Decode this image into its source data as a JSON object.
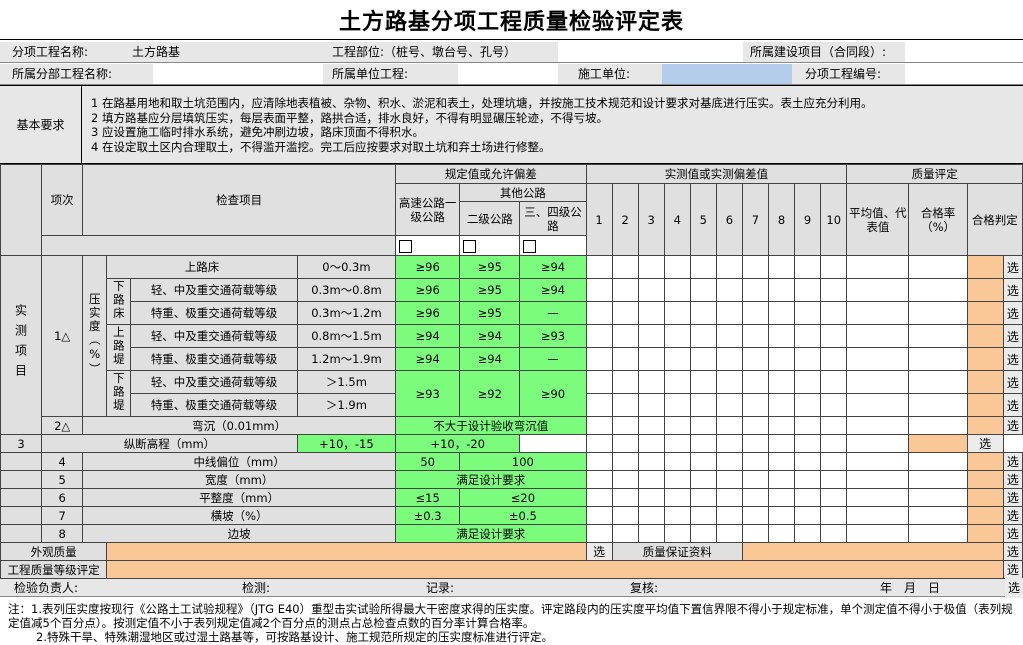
{
  "title": "土方路基分项工程质量检验评定表",
  "header": {
    "subitem_name_label": "分项工程名称:",
    "subitem_name_value": "土方路基",
    "location_label": "工程部位:（桩号、墩台号、孔号）",
    "project_label": "所属建设项目（合同段）:",
    "division_label": "所属分部工程名称:",
    "unit_label": "所属单位工程:",
    "contractor_label": "施工单位:",
    "code_label": "分项工程编号:"
  },
  "requirements": {
    "label": "基本要求",
    "lines": [
      "1 在路基用地和取土坑范围内，应清除地表植被、杂物、积水、淤泥和表土，处理坑塘，并按施工技术规范和设计要求对基底进行压实。表土应充分利用。",
      "2 填方路基应分层填筑压实，每层表面平整，路拱合适，排水良好，不得有明显碾压轮迹，不得亏坡。",
      "3 应设置施工临时排水系统，避免冲刷边坡，路床顶面不得积水。",
      "4 在设定取土区内合理取土，不得滥开滥挖。完工后应按要求对取土坑和弃土场进行修整。"
    ]
  },
  "table": {
    "side_label": "实测项目",
    "col_item_no": "项次",
    "col_check_item": "检查项目",
    "col_tolerance": "规定值或允许偏差",
    "col_highway": "高速公路一级公路",
    "col_other": "其他公路",
    "col_second": "二级公路",
    "col_third": "三、四级公路",
    "col_measured": "实测值或实测偏差值",
    "measure_cols": [
      "1",
      "2",
      "3",
      "4",
      "5",
      "6",
      "7",
      "8",
      "9",
      "10"
    ],
    "col_quality": "质量评定",
    "col_avg": "平均值、代表值",
    "col_rate": "合格率（%）",
    "col_judge": "合格判定",
    "select_label": "选",
    "item1_no": "1△",
    "compaction_label": "压实度（%）",
    "lower_bed": "下路床",
    "upper_embank": "上路堤",
    "lower_embank": "下路堤",
    "compaction": [
      {
        "name": "上路床",
        "depth": "0～0.3m",
        "highway": "≥96",
        "second": "≥95",
        "third": "≥94"
      },
      {
        "name": "轻、中及重交通荷载等级",
        "depth": "0.3m～0.8m",
        "highway": "≥96",
        "second": "≥95",
        "third": "≥94"
      },
      {
        "name": "特重、极重交通荷载等级",
        "depth": "0.3m～1.2m",
        "highway": "≥96",
        "second": "≥95",
        "third": "—"
      },
      {
        "name": "轻、中及重交通荷载等级",
        "depth": "0.8m～1.5m",
        "highway": "≥94",
        "second": "≥94",
        "third": "≥93"
      },
      {
        "name": "特重、极重交通荷载等级",
        "depth": "1.2m～1.9m",
        "highway": "≥94",
        "second": "≥94",
        "third": "—"
      },
      {
        "name": "轻、中及重交通荷载等级",
        "depth": "＞1.5m"
      },
      {
        "name": "特重、极重交通荷载等级",
        "depth": "＞1.9m"
      }
    ],
    "lower_embank_values": {
      "highway": "≥93",
      "second": "≥92",
      "third": "≥90"
    },
    "items": [
      {
        "no": "2△",
        "name": "弯沉（0.01mm）",
        "value": "不大于设计验收弯沉值"
      },
      {
        "no": "3",
        "name": "纵断高程（mm）",
        "highway": "+10，-15",
        "other": "+10，-20"
      },
      {
        "no": "4",
        "name": "中线偏位（mm）",
        "highway": "50",
        "other": "100"
      },
      {
        "no": "5",
        "name": "宽度（mm）",
        "value": "满足设计要求"
      },
      {
        "no": "6",
        "name": "平整度（mm）",
        "highway": "≤15",
        "other": "≤20"
      },
      {
        "no": "7",
        "name": "横坡（%）",
        "highway": "±0.3",
        "other": "±0.5"
      },
      {
        "no": "8",
        "name": "边坡",
        "value": "满足设计要求"
      }
    ],
    "appearance_label": "外观质量",
    "assurance_label": "质量保证资料",
    "grade_label": "工程质量等级评定"
  },
  "sign": {
    "inspector": "检验负责人:",
    "check": "检测:",
    "record": "记录:",
    "review": "复核:",
    "date": "年　月　日",
    "select": "选"
  },
  "notes": [
    "注：1.表列压实度按现行《公路土工试验规程》（JTG E40）重型击实试验所得最大干密度求得的压实度。评定路段内的压实度平均值下置信界限不得小于规定标准，单个测定值不得小于极值（表列规定值减5个百分点）。按测定值不小于表列规定值减2个百分点的测点占总检查点数的百分率计算合格率。",
    "2.特殊干旱、特殊潮湿地区或过湿土路基等，可按路基设计、施工规范所规定的压实度标准进行评定。"
  ]
}
